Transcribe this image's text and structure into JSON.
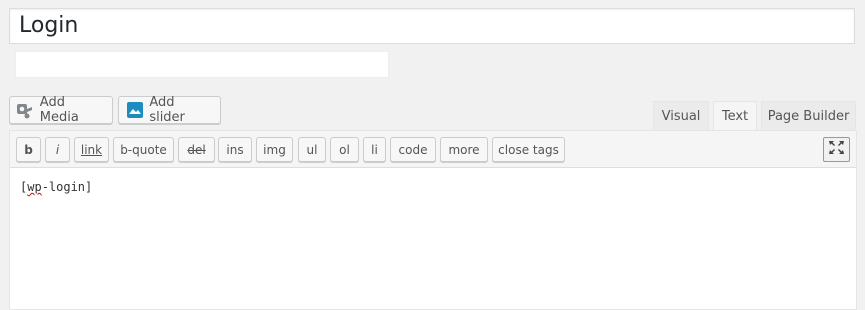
{
  "post": {
    "title": "Login",
    "permalink": ""
  },
  "media_buttons": [
    {
      "label": "Add Media",
      "icon": "camera-music-icon"
    },
    {
      "label": "Add slider",
      "icon": "slider-icon"
    }
  ],
  "editor_tabs": [
    {
      "label": "Visual",
      "active": false
    },
    {
      "label": "Text",
      "active": true
    },
    {
      "label": "Page Builder",
      "active": false
    }
  ],
  "quicktags": [
    "b",
    "i",
    "link",
    "b-quote",
    "del",
    "ins",
    "img",
    "ul",
    "ol",
    "li",
    "code",
    "more",
    "close tags"
  ],
  "content": {
    "open_bracket": "[",
    "misspelled": "wp",
    "rest": "-login]"
  },
  "colors": {
    "slider_icon": "#1e8cbe",
    "spellcheck": "#dd0000"
  }
}
